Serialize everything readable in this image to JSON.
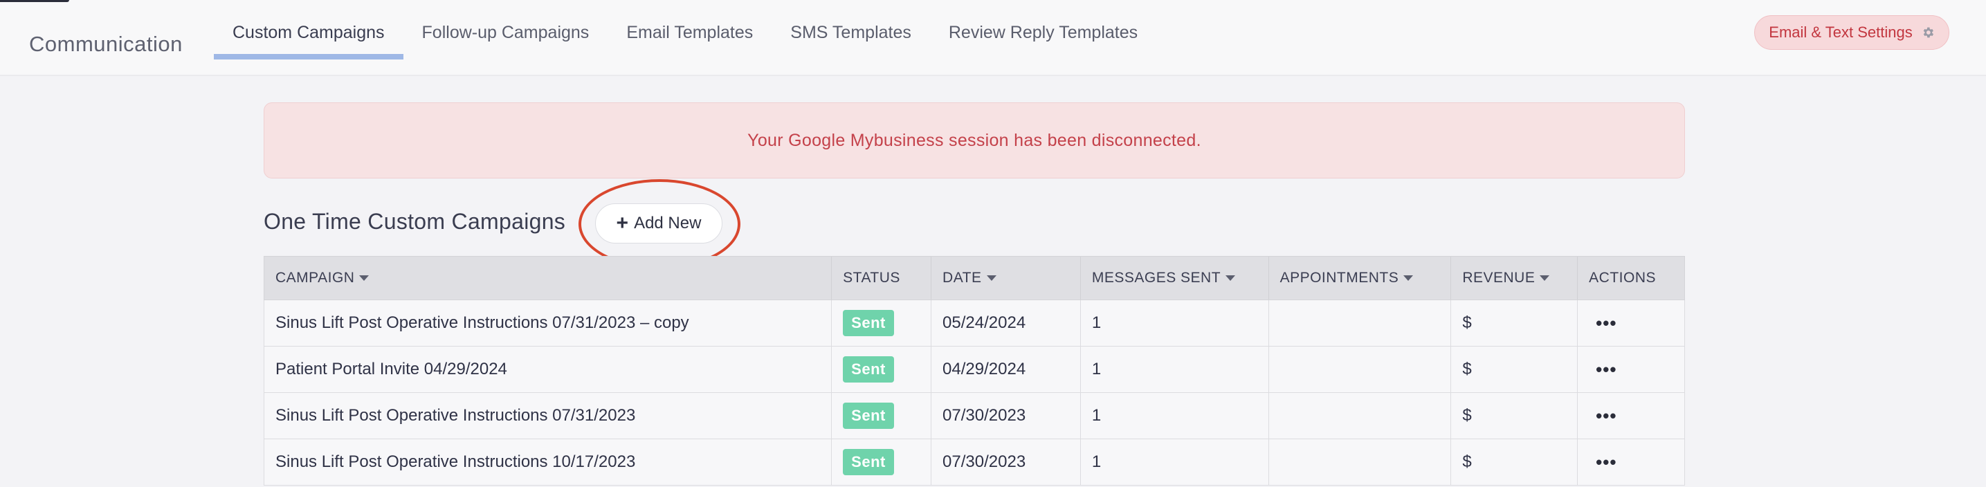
{
  "header": {
    "app_title": "Communication",
    "tabs": [
      {
        "label": "Custom Campaigns",
        "active": true
      },
      {
        "label": "Follow-up Campaigns",
        "active": false
      },
      {
        "label": "Email Templates",
        "active": false
      },
      {
        "label": "SMS Templates",
        "active": false
      },
      {
        "label": "Review Reply Templates",
        "active": false
      }
    ],
    "settings_label": "Email & Text Settings",
    "settings_icon": "gear-icon"
  },
  "alert": {
    "message": "Your Google Mybusiness session has been disconnected."
  },
  "section": {
    "title": "One Time Custom Campaigns",
    "add_label": "Add New"
  },
  "table": {
    "columns": [
      {
        "label": "CAMPAIGN",
        "sortable": true
      },
      {
        "label": "STATUS",
        "sortable": false
      },
      {
        "label": "DATE",
        "sortable": true
      },
      {
        "label": "MESSAGES SENT",
        "sortable": true
      },
      {
        "label": "APPOINTMENTS",
        "sortable": true
      },
      {
        "label": "REVENUE",
        "sortable": true
      },
      {
        "label": "ACTIONS",
        "sortable": false
      }
    ],
    "rows": [
      {
        "campaign": "Sinus Lift Post Operative Instructions 07/31/2023 – copy",
        "status": "Sent",
        "date": "05/24/2024",
        "messages_sent": "1",
        "appointments": "",
        "revenue": "$",
        "actions": "•••"
      },
      {
        "campaign": "Patient Portal Invite 04/29/2024",
        "status": "Sent",
        "date": "04/29/2024",
        "messages_sent": "1",
        "appointments": "",
        "revenue": "$",
        "actions": "•••"
      },
      {
        "campaign": "Sinus Lift Post Operative Instructions 07/31/2023",
        "status": "Sent",
        "date": "07/30/2023",
        "messages_sent": "1",
        "appointments": "",
        "revenue": "$",
        "actions": "•••"
      },
      {
        "campaign": "Sinus Lift Post Operative Instructions 10/17/2023",
        "status": "Sent",
        "date": "07/30/2023",
        "messages_sent": "1",
        "appointments": "",
        "revenue": "$",
        "actions": "•••"
      }
    ]
  },
  "colors": {
    "accent_tab_underline": "#9fb8e6",
    "alert_text": "#c4414a",
    "status_sent": "#6fd3ab",
    "highlight_ring": "#d9472e"
  }
}
